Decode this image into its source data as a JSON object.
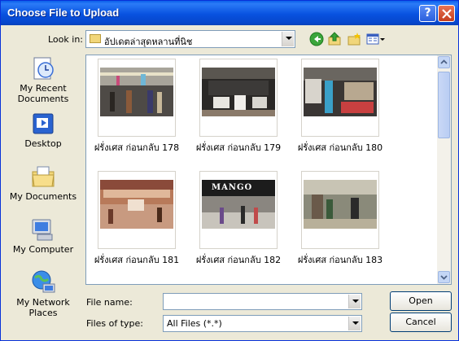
{
  "title": "Choose File to Upload",
  "look_in": {
    "label": "Look in:",
    "value": "อัปเดตล่าสุดหลานที่นิช"
  },
  "places": [
    {
      "label": "My Recent Documents"
    },
    {
      "label": "Desktop"
    },
    {
      "label": "My Documents"
    },
    {
      "label": "My Computer"
    },
    {
      "label": "My Network Places"
    }
  ],
  "files": [
    {
      "name": "ฝรั่งเศส ก่อนกลับ 178"
    },
    {
      "name": "ฝรั่งเศส ก่อนกลับ 179"
    },
    {
      "name": "ฝรั่งเศส ก่อนกลับ 180"
    },
    {
      "name": "ฝรั่งเศส ก่อนกลับ 181"
    },
    {
      "name": "ฝรั่งเศส ก่อนกลับ 182"
    },
    {
      "name": "ฝรั่งเศส ก่อนกลับ 183"
    }
  ],
  "mango_sign": "MANGO",
  "file_name": {
    "label": "File name:",
    "value": ""
  },
  "file_type": {
    "label": "Files of type:",
    "value": "All Files (*.*)"
  },
  "buttons": {
    "open": "Open",
    "cancel": "Cancel"
  },
  "colors": {
    "title_bar": "#0852e0",
    "dialog_bg": "#ece9d8",
    "close": "#c43d1d"
  }
}
